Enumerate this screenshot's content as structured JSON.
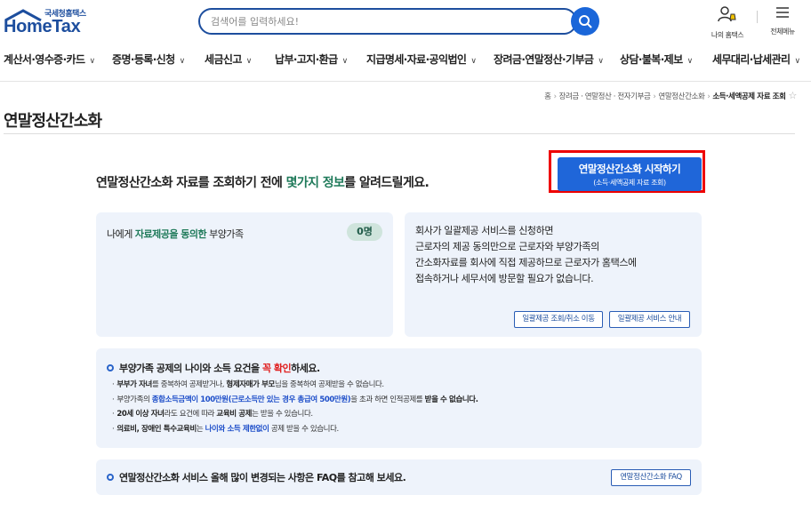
{
  "header": {
    "logo_sub": "국세청홈택스",
    "logo_main": "HomeTax",
    "search_placeholder": "검색어를 입력하세요!",
    "my_home_label": "나의 홈택스",
    "all_menu_label": "전체메뉴"
  },
  "gnb": {
    "items": [
      {
        "label": "계산서·영수증·카드"
      },
      {
        "label": "증명·등록·신청"
      },
      {
        "label": "세금신고"
      },
      {
        "label": "납부·고지·환급"
      },
      {
        "label": "지급명세·자료·공익법인"
      },
      {
        "label": "장려금·연말정산·기부금"
      },
      {
        "label": "상담·불복·제보"
      },
      {
        "label": "세무대리·납세관리"
      }
    ]
  },
  "breadcrumb": {
    "items": [
      "홈",
      "장려금 · 연말정산 · 전자기부금",
      "연말정산간소화"
    ],
    "current": "소득·세액공제 자료 조회"
  },
  "page": {
    "title": "연말정산간소화",
    "intro_before": "연말정산간소화 자료를 조회하기 전에 ",
    "intro_highlight": "몇가지 정보",
    "intro_after": "를 알려드릴게요.",
    "start_button": {
      "line1": "연말정산간소화 시작하기",
      "line2": "(소득·세액공제 자료 조회)"
    }
  },
  "dependents_card": {
    "prefix": "나에게 ",
    "highlight": "자료제공을 동의한",
    "suffix": " 부양가족",
    "count": "0명"
  },
  "bulk_card": {
    "lines": [
      "회사가 일괄제공 서비스를 신청하면",
      "근로자의 제공 동의만으로 근로자와 부양가족의",
      "간소화자료를 회사에 직접 제공하므로 근로자가 홈택스에",
      "접속하거나 세무서에 방문할 필요가 없습니다."
    ],
    "btn_query": "일괄제공 조회/취소 이동",
    "btn_guide": "일괄제공 서비스 안내"
  },
  "requirements": {
    "title_before": "부양가족 공제의 나이와 소득 요건을 ",
    "title_highlight": "꼭 확인",
    "title_after": "하세요.",
    "items": [
      {
        "a": "부부가 자녀",
        "b": "를 중복하여 공제받거나, ",
        "c": "형제자매가 부모",
        "d": "님을 중복하여 공제받을 수 없습니다."
      },
      {
        "a": "부양가족의 ",
        "b": "종합소득금액이 100만원(근로소득만 있는 경우 총급여 500만원)",
        "c": "을 초과 하면 인적공제를 ",
        "d": "받을 수 없습니다."
      },
      {
        "a": "20세 이상 자녀",
        "b": "라도 요건에 따라 ",
        "c": "교육비 공제",
        "d": "는 받을 수 있습니다."
      },
      {
        "a": "의료비, 장애인 특수교육비",
        "b": "는 ",
        "c": "나이와 소득 제한없이",
        "d": " 공제 받을 수 있습니다."
      }
    ]
  },
  "faq": {
    "text": "연말정산간소화 서비스 올해 많이 변경되는 사항은 FAQ를 참고해 보세요.",
    "button": "연말정산간소화 FAQ"
  },
  "colors": {
    "brand": "#1d4e9e",
    "button_blue": "#1f66d9",
    "highlight_green": "#1f7a5a",
    "card_bg": "#eef3fb",
    "highlight_box": "#e00000"
  }
}
